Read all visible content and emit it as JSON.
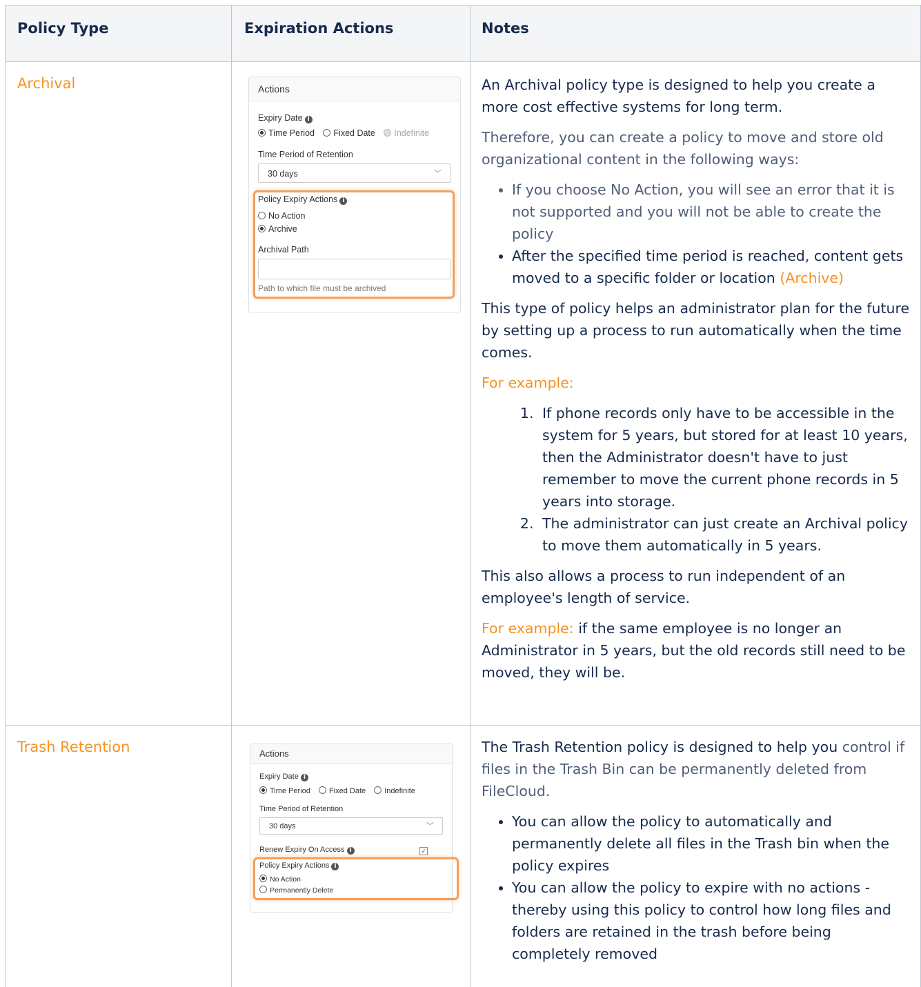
{
  "table": {
    "headers": {
      "policy_type": "Policy Type",
      "expiration_actions": "Expiration Actions",
      "notes": "Notes"
    }
  },
  "rows": [
    {
      "policy_type": "Archival",
      "panel": {
        "title": "Actions",
        "expiry_date_label": "Expiry Date",
        "expiry_options": [
          "Time Period",
          "Fixed Date",
          "Indefinite"
        ],
        "time_period_label": "Time Period of Retention",
        "time_period_value": "30 days",
        "policy_expiry_actions_label": "Policy Expiry Actions",
        "action_options": [
          "No Action",
          "Archive"
        ],
        "archival_path_label": "Archival Path",
        "archival_path_value": "",
        "archival_path_help": "Path to which file must be archived"
      },
      "notes": {
        "intro": "An Archival policy type is designed to help you create a more cost effective systems for long term.",
        "therefore": "Therefore, you can create a policy to move and store old organizational content in the following ways:",
        "bullet_1": "If you choose No Action, you will see an error that it is not supported and you will not be able to create the policy",
        "bullet_2": "After the specified time period is reached, content gets moved to a specific folder or location",
        "bullet_2_suffix": "(Archive)",
        "plan": "This type of policy helps an administrator plan for the future by setting up a process to run automatically when the time comes.",
        "for_example": "For example:",
        "example_1": "If phone records only have to be accessible in the system for 5 years, but stored for at least 10 years, then the Administrator doesn't have to just remember to move the current phone records in 5 years into storage.",
        "example_2": "The administrator can just create an Archival policy to move them automatically in 5 years.",
        "independent": "This also allows a process to run independent of an employee's length of service.",
        "for_example_2": "For example:",
        "example_text": "if the same employee is no longer an Administrator in 5 years, but the old records still need to be moved, they will be."
      }
    },
    {
      "policy_type": "Trash Retention",
      "panel": {
        "title": "Actions",
        "expiry_date_label": "Expiry Date",
        "expiry_options": [
          "Time Period",
          "Fixed Date",
          "Indefinite"
        ],
        "time_period_label": "Time Period of Retention",
        "time_period_value": "30 days",
        "renew_label": "Renew Expiry On Access",
        "policy_expiry_actions_label": "Policy Expiry Actions",
        "action_options": [
          "No Action",
          "Permanently Delete"
        ]
      },
      "notes": {
        "intro_a": "The Trash Retention policy is designed to help you",
        "intro_b": "control if files in the Trash Bin can be permanently deleted from FileCloud.",
        "bullet_1": "You can allow the policy to automatically and permanently delete all files in the Trash bin when the policy expires",
        "bullet_2": "You can allow the policy to expire with no actions - thereby using this policy to control how long files and folders are retained in the trash before being completely removed"
      }
    }
  ],
  "colors": {
    "accent": "#f6921e",
    "border": "#c1c7d0",
    "header_bg": "#f4f5f7",
    "highlight": "#f29f5a"
  }
}
